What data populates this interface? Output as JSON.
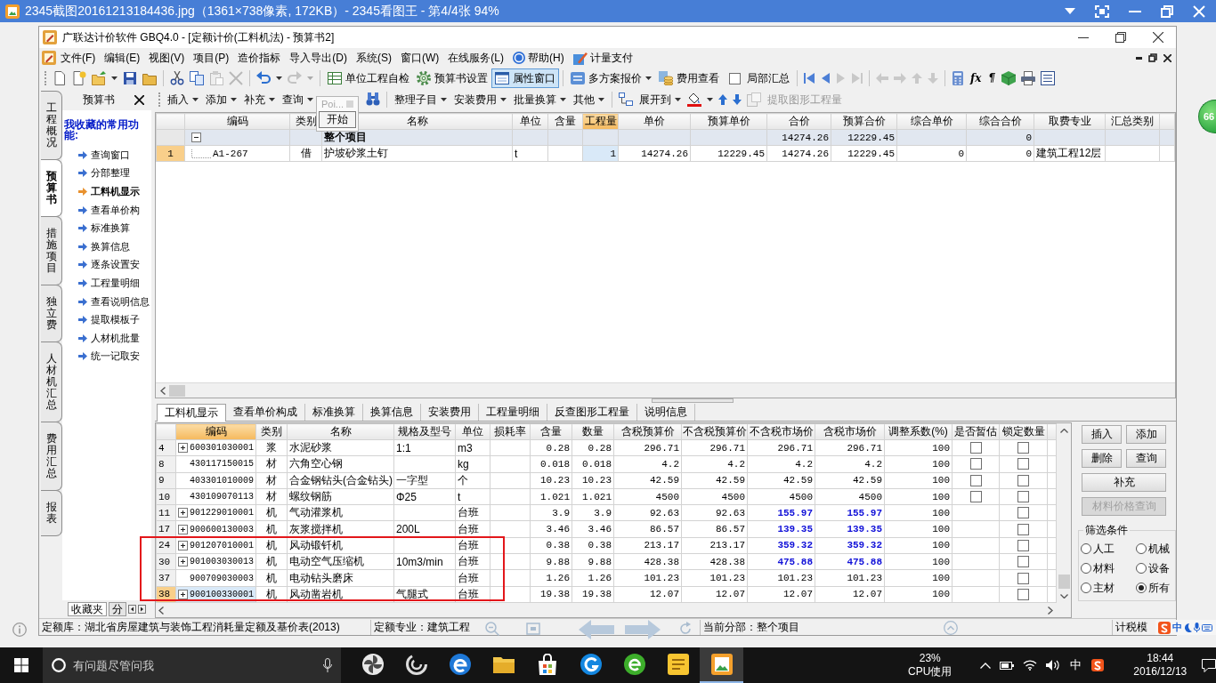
{
  "viewer": {
    "title": "2345截图20161213184436.jpg（1361×738像素, 172KB）- 2345看图王 - 第4/4张 94%",
    "badge": "66"
  },
  "app_title": "广联达计价软件 GBQ4.0 - [定额计价(工料机法) - 预算书2]",
  "menu": [
    "文件(F)",
    "编辑(E)",
    "视图(V)",
    "项目(P)",
    "造价指标",
    "导入导出(D)",
    "系统(S)",
    "窗口(W)",
    "在线服务(L)",
    "帮助(H)",
    "计量支付"
  ],
  "toolbar": {
    "buttons": [
      {
        "label": "单位工程自检",
        "selected": false,
        "dropdown": false
      },
      {
        "label": "预算书设置",
        "selected": false,
        "dropdown": false
      },
      {
        "label": "属性窗口",
        "selected": true,
        "dropdown": false
      },
      {
        "label": "多方案报价",
        "selected": false,
        "dropdown": true
      },
      {
        "label": "费用查看",
        "selected": false,
        "dropdown": false
      }
    ],
    "checkbox": {
      "label": "局部汇总",
      "checked": false
    },
    "symbols": [
      "fx",
      "¶"
    ]
  },
  "side_tabs": [
    {
      "label": "工程概况",
      "selected": false
    },
    {
      "label": "预算书",
      "selected": true
    },
    {
      "label": "措施项目",
      "selected": false
    },
    {
      "label": "独立费",
      "selected": false
    },
    {
      "label": "人材机汇总",
      "selected": false
    },
    {
      "label": "费用汇总",
      "selected": false
    },
    {
      "label": "报表",
      "selected": false
    }
  ],
  "sidebar": {
    "title": "预算书",
    "heading": "我收藏的常用功能:",
    "items": [
      {
        "label": "查询窗口",
        "selected": false
      },
      {
        "label": "分部整理",
        "selected": false
      },
      {
        "label": "工料机显示",
        "selected": true
      },
      {
        "label": "查看单价构",
        "selected": false
      },
      {
        "label": "标准换算",
        "selected": false
      },
      {
        "label": "换算信息",
        "selected": false
      },
      {
        "label": "逐条设置安",
        "selected": false
      },
      {
        "label": "工程量明细",
        "selected": false
      },
      {
        "label": "查看说明信息",
        "selected": false
      },
      {
        "label": "提取模板子",
        "selected": false
      },
      {
        "label": "人材机批量",
        "selected": false
      },
      {
        "label": "统一记取安",
        "selected": false
      }
    ],
    "tabs": [
      {
        "label": "收藏夹",
        "selected": true
      },
      {
        "label": "分",
        "selected": false
      }
    ]
  },
  "grid_toolbar": [
    {
      "label": "插入",
      "dropdown": true,
      "disabled": false
    },
    {
      "label": "添加",
      "dropdown": true,
      "disabled": false
    },
    {
      "label": "补充",
      "dropdown": true,
      "disabled": false
    },
    {
      "label": "查询",
      "dropdown": true,
      "disabled": false
    },
    {
      "label": "整理子目",
      "dropdown": true,
      "disabled": false
    },
    {
      "label": "安装费用",
      "dropdown": true,
      "disabled": false
    },
    {
      "label": "批量换算",
      "dropdown": true,
      "disabled": false
    },
    {
      "label": "其他",
      "dropdown": true,
      "disabled": false
    },
    {
      "label": "展开到",
      "dropdown": true,
      "disabled": false
    },
    {
      "label": "提取图形工程量",
      "dropdown": false,
      "disabled": true
    }
  ],
  "popup": {
    "hint": "Poi...",
    "button": "开始"
  },
  "top_table": {
    "columns": [
      {
        "label": "编码",
        "selected": false
      },
      {
        "label": "类别",
        "selected": false
      },
      {
        "label": "名称",
        "selected": false
      },
      {
        "label": "单位",
        "selected": false
      },
      {
        "label": "含量",
        "selected": false
      },
      {
        "label": "工程量",
        "selected": true
      },
      {
        "label": "单价",
        "selected": false
      },
      {
        "label": "预算单价",
        "selected": false
      },
      {
        "label": "合价",
        "selected": false
      },
      {
        "label": "预算合价",
        "selected": false
      },
      {
        "label": "综合单价",
        "selected": false
      },
      {
        "label": "综合合价",
        "selected": false
      },
      {
        "label": "取费专业",
        "selected": false
      },
      {
        "label": "汇总类别",
        "selected": false
      }
    ],
    "rows": [
      {
        "kind": "group",
        "selected": false,
        "expanded": true,
        "name": "整个项目",
        "total": "14274.26",
        "budget_total": "12229.45",
        "composite_total": "0"
      },
      {
        "kind": "item",
        "selected": true,
        "row_number": "1",
        "code": "A1-267",
        "type": "借",
        "name": "护坡砂浆土钉",
        "unit": "t",
        "quantity": "1",
        "unit_price": "14274.26",
        "budget_unit_price": "12229.45",
        "total": "14274.26",
        "budget_total": "12229.45",
        "composite_unit_price": "0",
        "composite_total": "0",
        "fee_category": "建筑工程12层"
      }
    ]
  },
  "detail_tabs": [
    {
      "label": "工料机显示",
      "selected": true
    },
    {
      "label": "查看单价构成",
      "selected": false
    },
    {
      "label": "标准换算",
      "selected": false
    },
    {
      "label": "换算信息",
      "selected": false
    },
    {
      "label": "安装费用",
      "selected": false
    },
    {
      "label": "工程量明细",
      "selected": false
    },
    {
      "label": "反查图形工程量",
      "selected": false
    },
    {
      "label": "说明信息",
      "selected": false
    }
  ],
  "detail_table": {
    "columns": [
      {
        "label": "编码",
        "selected": true
      },
      {
        "label": "类别",
        "selected": false
      },
      {
        "label": "名称",
        "selected": false
      },
      {
        "label": "规格及型号",
        "selected": false
      },
      {
        "label": "单位",
        "selected": false
      },
      {
        "label": "损耗率",
        "selected": false
      },
      {
        "label": "含量",
        "selected": false
      },
      {
        "label": "数量",
        "selected": false
      },
      {
        "label": "含税预算价",
        "selected": false
      },
      {
        "label": "不含税预算价",
        "selected": false
      },
      {
        "label": "不含税市场价",
        "selected": false
      },
      {
        "label": "含税市场价",
        "selected": false
      },
      {
        "label": "调整系数(%)",
        "selected": false
      },
      {
        "label": "是否暂估",
        "selected": false
      },
      {
        "label": "锁定数量",
        "selected": false
      }
    ],
    "rows": [
      {
        "row_number": "4",
        "selected": false,
        "expandable": true,
        "code": "600301030001",
        "type": "浆",
        "name": "水泥砂浆",
        "spec": "1:1",
        "unit": "m3",
        "content": "0.28",
        "amount": "0.28",
        "tax_budget_price": "296.71",
        "budget_price": "296.71",
        "market_price": "296.71",
        "tax_market_price": "296.71",
        "adjusted": false,
        "factor": "100",
        "provisional": false,
        "locked": false
      },
      {
        "row_number": "8",
        "selected": false,
        "expandable": false,
        "code": "430117150015",
        "type": "材",
        "name": "六角空心钢",
        "unit": "kg",
        "content": "0.018",
        "amount": "0.018",
        "tax_budget_price": "4.2",
        "budget_price": "4.2",
        "market_price": "4.2",
        "tax_market_price": "4.2",
        "adjusted": false,
        "factor": "100",
        "provisional": false,
        "locked": false
      },
      {
        "row_number": "9",
        "selected": false,
        "expandable": false,
        "code": "403301010009",
        "type": "材",
        "name": "合金钢钻头(合金钻头)",
        "spec": "一字型",
        "unit": "个",
        "content": "10.23",
        "amount": "10.23",
        "tax_budget_price": "42.59",
        "budget_price": "42.59",
        "market_price": "42.59",
        "tax_market_price": "42.59",
        "adjusted": false,
        "factor": "100",
        "provisional": false,
        "locked": false
      },
      {
        "row_number": "10",
        "selected": false,
        "expandable": false,
        "code": "430109070113",
        "type": "材",
        "name": "螺纹钢筋",
        "spec": "Φ25",
        "unit": "t",
        "content": "1.021",
        "amount": "1.021",
        "tax_budget_price": "4500",
        "budget_price": "4500",
        "market_price": "4500",
        "tax_market_price": "4500",
        "adjusted": false,
        "factor": "100",
        "provisional": false,
        "locked": false
      },
      {
        "row_number": "11",
        "selected": false,
        "expandable": true,
        "code": "901229010001",
        "type": "机",
        "name": "气动灌浆机",
        "unit": "台班",
        "content": "3.9",
        "amount": "3.9",
        "tax_budget_price": "92.63",
        "budget_price": "92.63",
        "market_price": "155.97",
        "tax_market_price": "155.97",
        "adjusted": true,
        "factor": "100",
        "locked": false
      },
      {
        "row_number": "17",
        "selected": false,
        "expandable": true,
        "code": "900600130003",
        "type": "机",
        "name": "灰浆搅拌机",
        "spec": "200L",
        "unit": "台班",
        "content": "3.46",
        "amount": "3.46",
        "tax_budget_price": "86.57",
        "budget_price": "86.57",
        "market_price": "139.35",
        "tax_market_price": "139.35",
        "adjusted": true,
        "factor": "100",
        "locked": false
      },
      {
        "row_number": "24",
        "selected": false,
        "expandable": true,
        "code": "901207010001",
        "type": "机",
        "name": "风动锻钎机",
        "unit": "台班",
        "content": "0.38",
        "amount": "0.38",
        "tax_budget_price": "213.17",
        "budget_price": "213.17",
        "market_price": "359.32",
        "tax_market_price": "359.32",
        "adjusted": true,
        "factor": "100",
        "locked": false
      },
      {
        "row_number": "30",
        "selected": false,
        "expandable": true,
        "code": "901003030013",
        "type": "机",
        "name": "电动空气压缩机",
        "spec": "10m3/min",
        "unit": "台班",
        "content": "9.88",
        "amount": "9.88",
        "tax_budget_price": "428.38",
        "budget_price": "428.38",
        "market_price": "475.88",
        "tax_market_price": "475.88",
        "adjusted": true,
        "factor": "100",
        "locked": false
      },
      {
        "row_number": "37",
        "selected": false,
        "expandable": false,
        "code": "900709030003",
        "type": "机",
        "name": "电动钻头磨床",
        "unit": "台班",
        "content": "1.26",
        "amount": "1.26",
        "tax_budget_price": "101.23",
        "budget_price": "101.23",
        "market_price": "101.23",
        "tax_market_price": "101.23",
        "adjusted": false,
        "factor": "100",
        "locked": false
      },
      {
        "row_number": "38",
        "selected": true,
        "expandable": true,
        "code": "900100330001",
        "type": "机",
        "name": "风动凿岩机",
        "spec": "气腿式",
        "unit": "台班",
        "content": "19.38",
        "amount": "19.38",
        "tax_budget_price": "12.07",
        "budget_price": "12.07",
        "market_price": "12.07",
        "tax_market_price": "12.07",
        "adjusted": false,
        "factor": "100",
        "locked": false
      }
    ]
  },
  "actions": [
    {
      "label": "插入",
      "disabled": false
    },
    {
      "label": "添加",
      "disabled": false
    },
    {
      "label": "删除",
      "disabled": false
    },
    {
      "label": "查询",
      "disabled": false
    },
    {
      "label": "补充",
      "disabled": false
    },
    {
      "label": "材料价格查询",
      "disabled": true
    }
  ],
  "filter": {
    "title": "筛选条件",
    "options": [
      {
        "label": "人工",
        "selected": false
      },
      {
        "label": "机械",
        "selected": false
      },
      {
        "label": "材料",
        "selected": false
      },
      {
        "label": "设备",
        "selected": false
      },
      {
        "label": "主材",
        "selected": false
      },
      {
        "label": "所有",
        "selected": true
      }
    ]
  },
  "status_bar": [
    "定额库：湖北省房屋建筑与装饰工程消耗量定额及基价表(2013)",
    "定额专业：建筑工程",
    "当前分部：整个项目",
    "计税模"
  ],
  "ime_bar": {
    "mode": "中"
  },
  "taskbar": {
    "search_placeholder": "有问题尽管问我",
    "apps": [
      {
        "selected": false
      },
      {
        "selected": false
      },
      {
        "selected": false
      },
      {
        "selected": false
      },
      {
        "selected": false
      },
      {
        "selected": false
      },
      {
        "selected": false
      },
      {
        "selected": false
      },
      {
        "selected": true
      }
    ],
    "cpu_percent": "23%",
    "cpu_label": "CPU使用",
    "input_mode": "中",
    "time": "18:44",
    "date": "2016/12/13"
  }
}
